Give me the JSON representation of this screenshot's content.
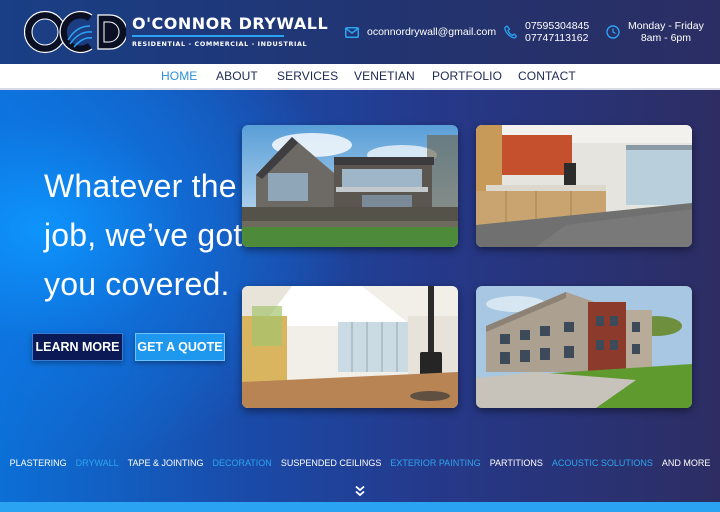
{
  "brand": {
    "logo_text": "OCD",
    "name": "O'CONNOR DRYWALL",
    "tagline": "RESIDENTIAL - COMMERCIAL - INDUSTRIAL",
    "accent": "#2aa3f2"
  },
  "contact": {
    "email": "oconnordrywall@gmail.com",
    "phone_1": "07595304845",
    "phone_2": "07747113162",
    "hours_days": "Monday - Friday",
    "hours_time": "8am - 6pm",
    "icons": [
      "envelope-icon",
      "phone-icon",
      "clock-icon"
    ]
  },
  "nav": {
    "items": [
      {
        "label": "HOME",
        "active": true
      },
      {
        "label": "ABOUT"
      },
      {
        "label": "SERVICES"
      },
      {
        "label": "VENETIAN"
      },
      {
        "label": "PORTFOLIO"
      },
      {
        "label": "CONTACT"
      }
    ]
  },
  "hero": {
    "headline_1": "Whatever the",
    "headline_2": "job, we’ve got",
    "headline_3": "you covered.",
    "learn_more": "LEARN MORE",
    "get_quote": "GET A QUOTE"
  },
  "services": [
    {
      "label": "PLASTERING",
      "highlight": false
    },
    {
      "label": "DRYWALL",
      "highlight": true
    },
    {
      "label": "TAPE & JOINTING",
      "highlight": false
    },
    {
      "label": "DECORATION",
      "highlight": true
    },
    {
      "label": "SUSPENDED CEILINGS",
      "highlight": false
    },
    {
      "label": "EXTERIOR PAINTING",
      "highlight": true
    },
    {
      "label": "PARTITIONS",
      "highlight": false
    },
    {
      "label": "ACOUSTIC SOLUTIONS",
      "highlight": true
    },
    {
      "label": "AND MORE",
      "highlight": false
    }
  ],
  "scroll_icon": "double-chevron-down-icon"
}
